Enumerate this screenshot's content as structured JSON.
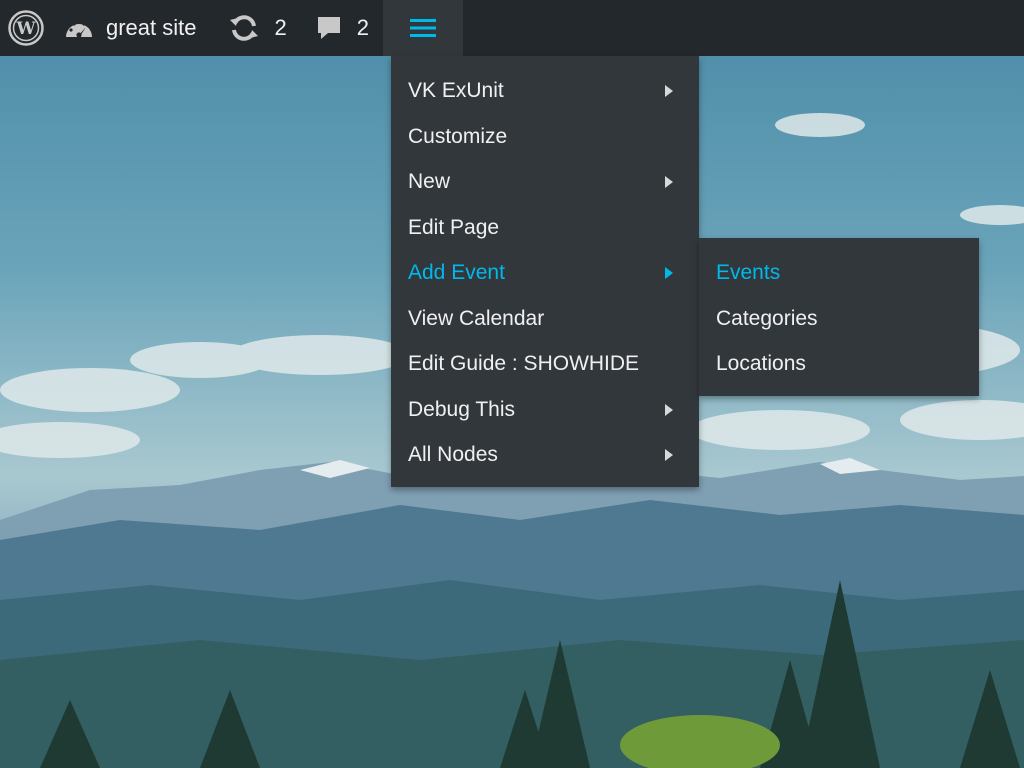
{
  "adminbar": {
    "site_name": "great site",
    "updates_count": "2",
    "comments_count": "2",
    "icons": {
      "logo": "wordpress-logo-icon",
      "dashboard": "dashboard-gauge-icon",
      "updates": "refresh-icon",
      "comments": "comment-bubble-icon",
      "menu": "hamburger-menu-icon"
    },
    "colors": {
      "bar": "#23282d",
      "active_tab": "#32373c",
      "accent": "#00b9eb"
    }
  },
  "main_menu": {
    "items": [
      {
        "label": "VK ExUnit",
        "has_submenu": true
      },
      {
        "label": "Customize",
        "has_submenu": false
      },
      {
        "label": "New",
        "has_submenu": true
      },
      {
        "label": "Edit Page",
        "has_submenu": false
      },
      {
        "label": "Add Event",
        "has_submenu": true,
        "active": true
      },
      {
        "label": "View Calendar",
        "has_submenu": false
      },
      {
        "label": "Edit Guide : SHOWHIDE",
        "has_submenu": false
      },
      {
        "label": "Debug This",
        "has_submenu": true
      },
      {
        "label": "All Nodes",
        "has_submenu": true
      }
    ]
  },
  "sub_menu": {
    "items": [
      {
        "label": "Events",
        "active": true
      },
      {
        "label": "Categories"
      },
      {
        "label": "Locations"
      }
    ]
  }
}
